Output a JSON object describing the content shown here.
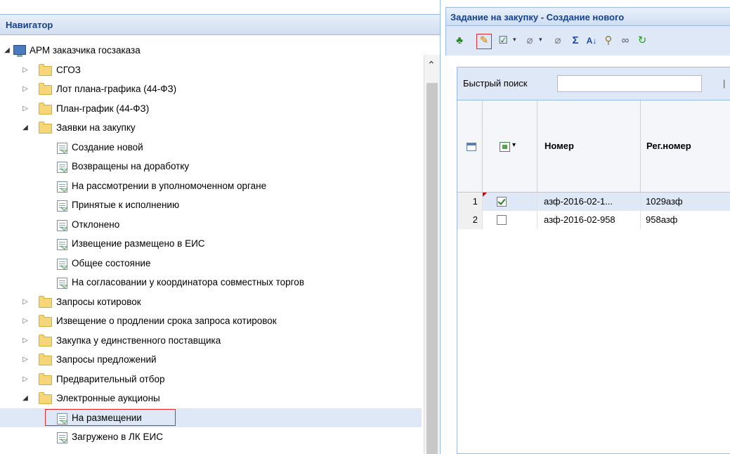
{
  "navigator": {
    "title": "Навигатор",
    "tree": [
      {
        "label": "АРМ заказчика госзаказа",
        "type": "root",
        "depth": 0,
        "expanded": true
      },
      {
        "label": "СГОЗ",
        "type": "folder",
        "depth": 1,
        "expanded": false
      },
      {
        "label": "Лот плана-графика (44-ФЗ)",
        "type": "folder",
        "depth": 1,
        "expanded": false
      },
      {
        "label": "План-график (44-ФЗ)",
        "type": "folder",
        "depth": 1,
        "expanded": false
      },
      {
        "label": "Заявки на закупку",
        "type": "folder",
        "depth": 1,
        "expanded": true
      },
      {
        "label": "Создание новой",
        "type": "doc",
        "depth": 2
      },
      {
        "label": "Возвращены на доработку",
        "type": "doc",
        "depth": 2
      },
      {
        "label": "На рассмотрении в уполномоченном органе",
        "type": "doc",
        "depth": 2
      },
      {
        "label": "Принятые к исполнению",
        "type": "doc",
        "depth": 2
      },
      {
        "label": "Отклонено",
        "type": "doc",
        "depth": 2
      },
      {
        "label": "Извещение размещено в ЕИС",
        "type": "doc",
        "depth": 2
      },
      {
        "label": "Общее состояние",
        "type": "doc",
        "depth": 2
      },
      {
        "label": "На согласовании у координатора совместных торгов",
        "type": "doc",
        "depth": 2
      },
      {
        "label": "Запросы котировок",
        "type": "folder",
        "depth": 1,
        "expanded": false
      },
      {
        "label": "Извещение о продлении срока запроса котировок",
        "type": "folder",
        "depth": 1,
        "expanded": false
      },
      {
        "label": "Закупка у единственного поставщика",
        "type": "folder",
        "depth": 1,
        "expanded": false
      },
      {
        "label": "Запросы предложений",
        "type": "folder",
        "depth": 1,
        "expanded": false
      },
      {
        "label": "Предварительный отбор",
        "type": "folder",
        "depth": 1,
        "expanded": false
      },
      {
        "label": "Электронные аукционы",
        "type": "folder",
        "depth": 1,
        "expanded": true
      },
      {
        "label": "На размещении",
        "type": "doc",
        "depth": 2,
        "selected": true,
        "highlighted": true
      },
      {
        "label": "Загружено в ЛК ЕИС",
        "type": "doc",
        "depth": 2
      }
    ]
  },
  "panel": {
    "title": "Задание на закупку - Создание нового",
    "toolbar_icons": [
      "add-org-icon",
      "edit-icon",
      "approve-icon",
      "attach-icon",
      "attach-icon-2",
      "sum-icon",
      "sort-icon",
      "filter-icon",
      "link-icon",
      "refresh-icon"
    ],
    "search": {
      "label": "Быстрый поиск",
      "value": "",
      "separator": "|"
    },
    "columns": {
      "number": "Номер",
      "reg_number": "Рег.номер"
    },
    "rows": [
      {
        "n": "1",
        "checked": true,
        "number": "азф-2016-02-1...",
        "reg_number": "1029азф",
        "selected": true,
        "dirty": true
      },
      {
        "n": "2",
        "checked": false,
        "number": "азф-2016-02-958",
        "reg_number": "958азф",
        "selected": false,
        "dirty": false
      }
    ]
  },
  "colors": {
    "header_text": "#15428b",
    "selection": "#dfe8f6",
    "highlight_border": "#e0282e"
  }
}
